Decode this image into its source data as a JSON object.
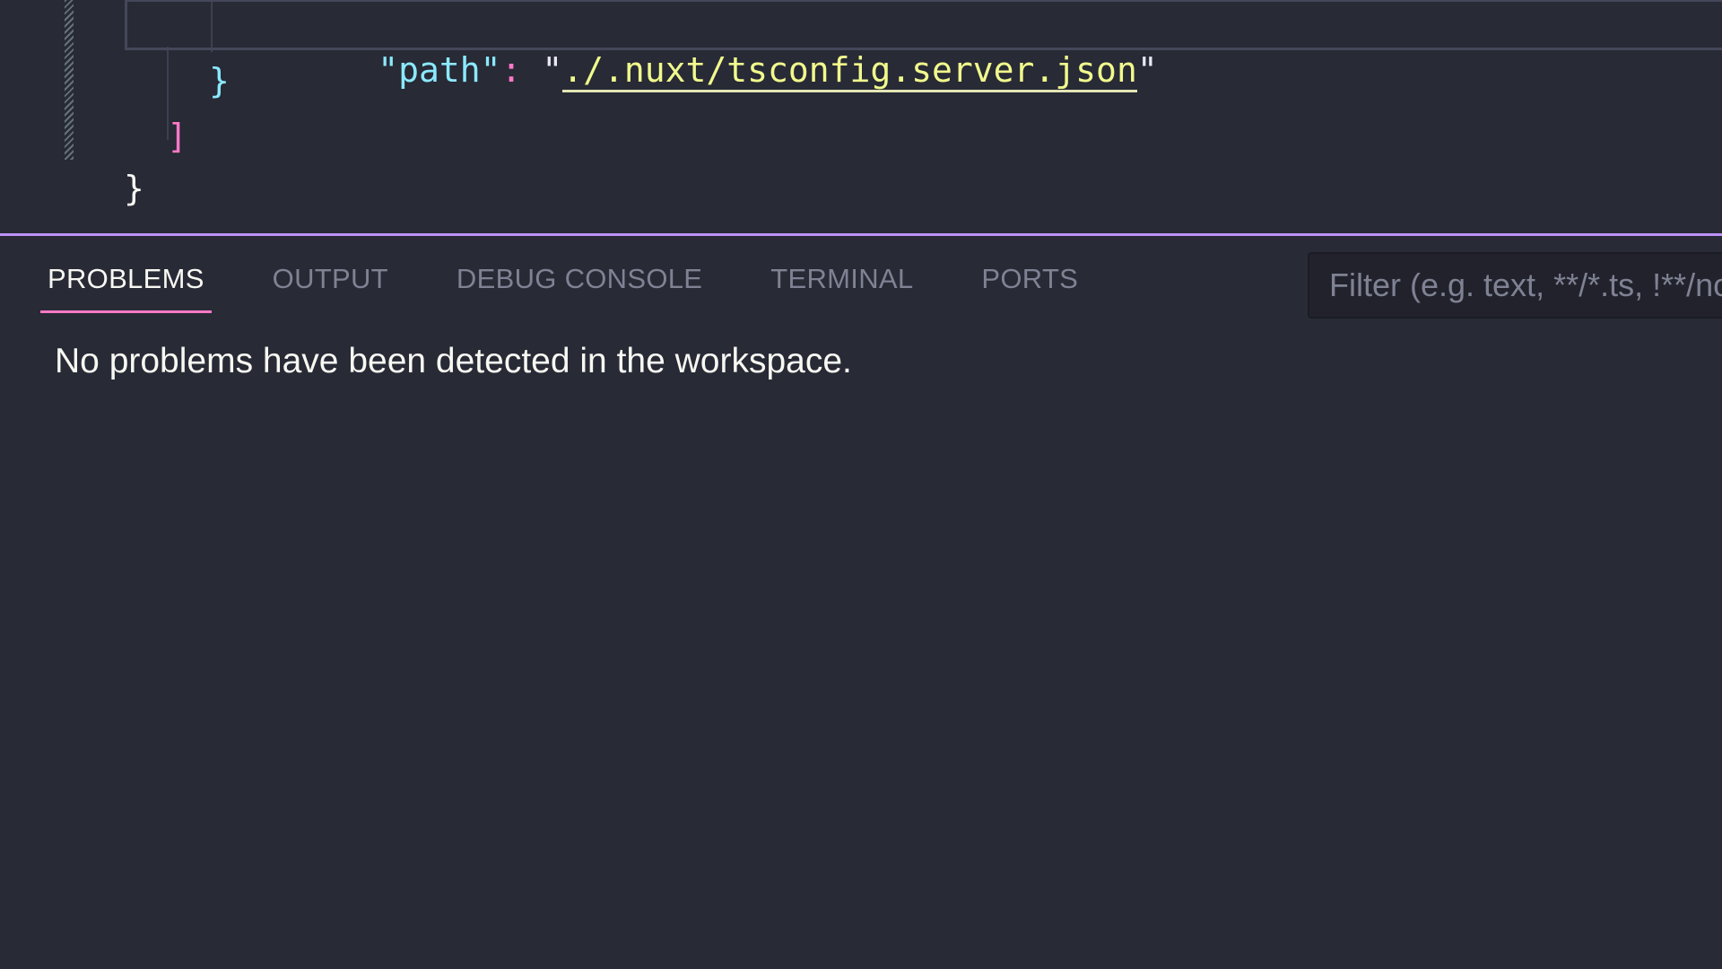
{
  "editor": {
    "line_path": {
      "key": "\"path\"",
      "colon": ":",
      "value_open_quote": "\"",
      "value": "./.nuxt/tsconfig.server.json",
      "value_close_quote": "\""
    },
    "line_close_object": "}",
    "line_close_array": "]",
    "line_close_root": "}"
  },
  "panel": {
    "tabs": [
      {
        "label": "PROBLEMS",
        "active": true
      },
      {
        "label": "OUTPUT",
        "active": false
      },
      {
        "label": "DEBUG CONSOLE",
        "active": false
      },
      {
        "label": "TERMINAL",
        "active": false
      },
      {
        "label": "PORTS",
        "active": false
      }
    ],
    "filter_placeholder": "Filter (e.g. text, **/*.ts, !**/node_modules/**)",
    "message": "No problems have been detected in the workspace."
  },
  "colors": {
    "background": "#282a36",
    "active_tab_underline": "#ff79c6",
    "sash": "#bd93f9",
    "string": "#f1fa8c",
    "key": "#8be9fd"
  }
}
